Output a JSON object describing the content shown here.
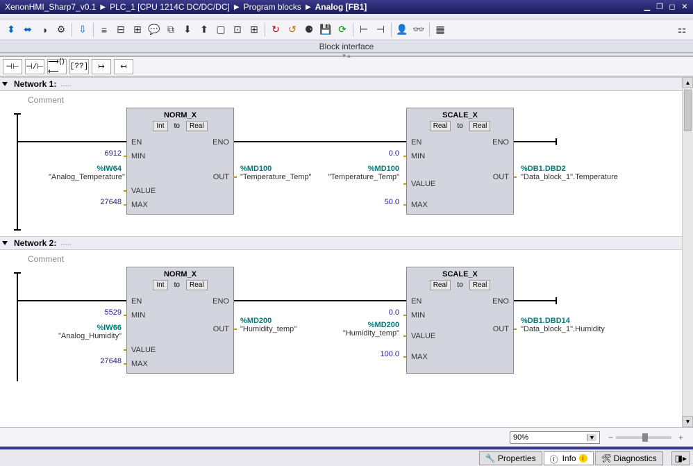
{
  "breadcrumb": {
    "p0": "XenonHMI_Sharp7_v0.1",
    "p1": "PLC_1 [CPU 1214C DC/DC/DC]",
    "p2": "Program blocks",
    "p3": "Analog [FB1]"
  },
  "blockInterfaceLabel": "Block interface",
  "toolbar_icons": [
    "go-online",
    "go-offline",
    "monitor",
    "compile",
    "download",
    "list",
    "indent",
    "outdent",
    "comment-toggle",
    "compare",
    "download-2",
    "upload",
    "box",
    "collapse",
    "expand",
    "redo-stop",
    "undo",
    "network",
    "save",
    "sync",
    "divider-1",
    "divider-2",
    "user",
    "goggles",
    "overview"
  ],
  "toolbar_right_icon": "options",
  "lad_icons": [
    "open-contact",
    "closed-contact",
    "coil",
    "box-q",
    "branch-open",
    "branch-close"
  ],
  "network1": {
    "title": "Network 1:",
    "dots": ".....",
    "comment": "Comment",
    "norm": {
      "title": "NORM_X",
      "type_l": "Int",
      "type_m": "to",
      "type_r": "Real",
      "en": "EN",
      "eno": "ENO",
      "min": "MIN",
      "value": "VALUE",
      "max": "MAX",
      "out": "OUT",
      "min_val": "6912",
      "value_addr": "%IW64",
      "value_name": "\"Analog_Temperature\"",
      "max_val": "27648",
      "out_addr": "%MD100",
      "out_name": "\"Temperature_Temp\""
    },
    "scale": {
      "title": "SCALE_X",
      "type_l": "Real",
      "type_m": "to",
      "type_r": "Real",
      "en": "EN",
      "eno": "ENO",
      "min": "MIN",
      "value": "VALUE",
      "max": "MAX",
      "out": "OUT",
      "min_val": "0.0",
      "value_addr": "%MD100",
      "value_name": "\"Temperature_Temp\"",
      "max_val": "50.0",
      "out_addr": "%DB1.DBD2",
      "out_name": "\"Data_block_1\".Temperature"
    }
  },
  "network2": {
    "title": "Network 2:",
    "dots": ".....",
    "comment": "Comment",
    "norm": {
      "title": "NORM_X",
      "type_l": "Int",
      "type_m": "to",
      "type_r": "Real",
      "en": "EN",
      "eno": "ENO",
      "min": "MIN",
      "value": "VALUE",
      "max": "MAX",
      "out": "OUT",
      "min_val": "5529",
      "value_addr": "%IW66",
      "value_name": "\"Analog_Humidity\"",
      "max_val": "27648",
      "out_addr": "%MD200",
      "out_name": "\"Humidity_temp\""
    },
    "scale": {
      "title": "SCALE_X",
      "type_l": "Real",
      "type_m": "to",
      "type_r": "Real",
      "en": "EN",
      "eno": "ENO",
      "min": "MIN",
      "value": "VALUE",
      "max": "MAX",
      "out": "OUT",
      "min_val": "0.0",
      "value_addr": "%MD200",
      "value_name": "\"Humidity_temp\"",
      "max_val": "100.0",
      "out_addr": "%DB1.DBD14",
      "out_name": "\"Data_block_1\".Humidity"
    }
  },
  "zoom": {
    "value": "90%"
  },
  "status": {
    "properties": "Properties",
    "info": "Info",
    "diag": "Diagnostics"
  }
}
